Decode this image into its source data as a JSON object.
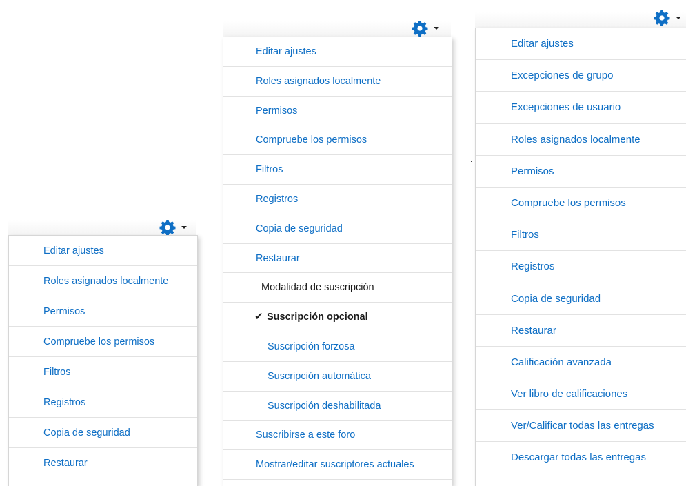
{
  "colors": {
    "link": "#0f6fc5",
    "text": "#1a1a1a",
    "gear": "#0f6fc5"
  },
  "icons": {
    "gear": "gear-icon",
    "caret": "caret-down-icon",
    "check": "check-icon"
  },
  "menu1": {
    "items": [
      {
        "label": "Editar ajustes"
      },
      {
        "label": "Roles asignados localmente"
      },
      {
        "label": "Permisos"
      },
      {
        "label": "Compruebe los permisos"
      },
      {
        "label": "Filtros"
      },
      {
        "label": "Registros"
      },
      {
        "label": "Copia de seguridad"
      },
      {
        "label": "Restaurar"
      }
    ]
  },
  "menu2": {
    "items": [
      {
        "label": "Editar ajustes"
      },
      {
        "label": "Roles asignados localmente"
      },
      {
        "label": "Permisos"
      },
      {
        "label": "Compruebe los permisos"
      },
      {
        "label": "Filtros"
      },
      {
        "label": "Registros"
      },
      {
        "label": "Copia de seguridad"
      },
      {
        "label": "Restaurar"
      }
    ],
    "subscription_header": "Modalidad de suscripción",
    "check_glyph": "✔",
    "subscription_options": [
      {
        "label": "Suscripción opcional",
        "selected": true
      },
      {
        "label": "Suscripción forzosa"
      },
      {
        "label": "Suscripción automática"
      },
      {
        "label": "Suscripción deshabilitada"
      }
    ],
    "footer_items": [
      {
        "label": "Suscribirse a este foro"
      },
      {
        "label": "Mostrar/editar suscriptores actuales"
      }
    ]
  },
  "menu3": {
    "items": [
      {
        "label": "Editar ajustes"
      },
      {
        "label": "Excepciones de grupo"
      },
      {
        "label": "Excepciones de usuario"
      },
      {
        "label": "Roles asignados localmente"
      },
      {
        "label": "Permisos"
      },
      {
        "label": "Compruebe los permisos"
      },
      {
        "label": "Filtros"
      },
      {
        "label": "Registros"
      },
      {
        "label": "Copia de seguridad"
      },
      {
        "label": "Restaurar"
      },
      {
        "label": "Calificación avanzada"
      },
      {
        "label": "Ver libro de calificaciones"
      },
      {
        "label": "Ver/Calificar todas las entregas"
      },
      {
        "label": "Descargar todas las entregas"
      }
    ]
  }
}
